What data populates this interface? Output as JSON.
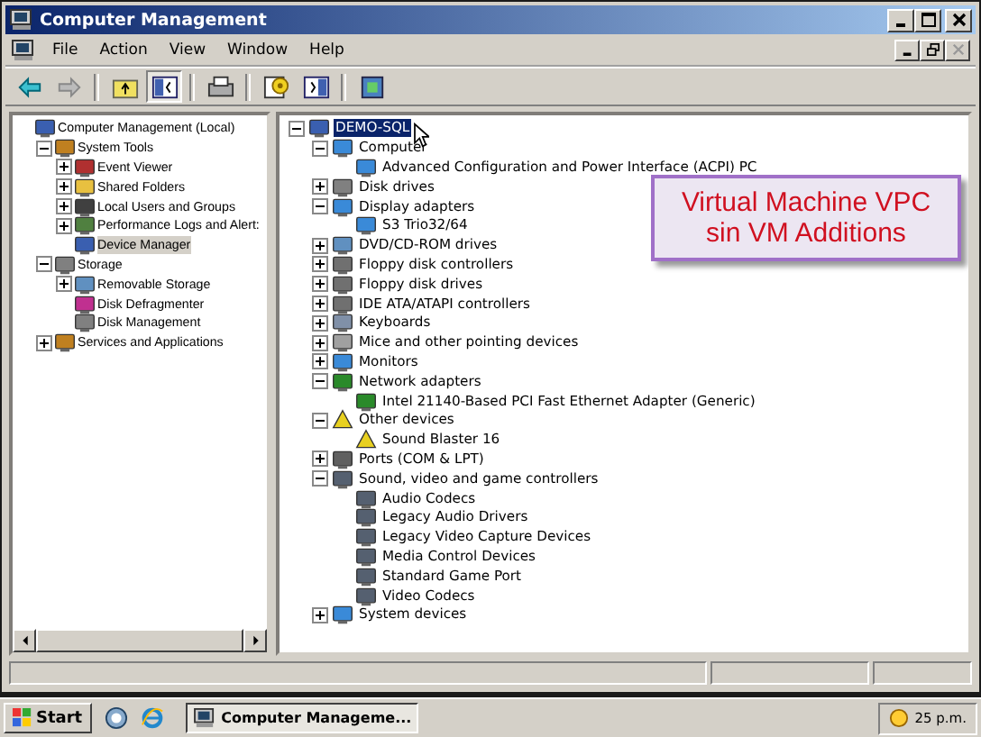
{
  "window": {
    "title": "Computer Management"
  },
  "menu": [
    "File",
    "Action",
    "View",
    "Window",
    "Help"
  ],
  "toolbar": [
    {
      "kind": "back"
    },
    {
      "kind": "forward"
    },
    {
      "kind": "sep"
    },
    {
      "kind": "up"
    },
    {
      "kind": "tree",
      "selected": true
    },
    {
      "kind": "sep"
    },
    {
      "kind": "print"
    },
    {
      "kind": "sep"
    },
    {
      "kind": "help"
    },
    {
      "kind": "pane",
      "selected": false
    },
    {
      "kind": "sep"
    },
    {
      "kind": "props"
    }
  ],
  "console_tree": [
    {
      "label": "Computer Management (Local)",
      "kind": "computer",
      "selected": false,
      "children": [
        {
          "label": "System Tools",
          "kind": "tools",
          "expanded": true,
          "selected": false,
          "children": [
            {
              "label": "Event Viewer",
              "kind": "log",
              "expanded": false,
              "selected": false
            },
            {
              "label": "Shared Folders",
              "kind": "folder",
              "expanded": false,
              "selected": false
            },
            {
              "label": "Local Users and Groups",
              "kind": "users",
              "expanded": false,
              "selected": false
            },
            {
              "label": "Performance Logs and Alert:",
              "kind": "chart",
              "expanded": false,
              "selected": false
            },
            {
              "label": "Device Manager",
              "kind": "computer",
              "selected": true
            }
          ]
        },
        {
          "label": "Storage",
          "kind": "drive",
          "expanded": true,
          "selected": false,
          "children": [
            {
              "label": "Removable Storage",
              "kind": "disc",
              "expanded": false,
              "selected": false
            },
            {
              "label": "Disk Defragmenter",
              "kind": "defrag",
              "selected": false
            },
            {
              "label": "Disk Management",
              "kind": "drive",
              "selected": false
            }
          ]
        },
        {
          "label": "Services and Applications",
          "kind": "tools",
          "expanded": false,
          "selected": false
        }
      ]
    }
  ],
  "device_tree": [
    {
      "label": "DEMO-SQL",
      "kind": "computer",
      "expanded": true,
      "selected": true,
      "children": [
        {
          "label": "Computer",
          "kind": "monitor",
          "expanded": true,
          "selected": false,
          "children": [
            {
              "label": "Advanced Configuration and Power Interface (ACPI) PC",
              "kind": "monitor",
              "selected": false
            }
          ]
        },
        {
          "label": "Disk drives",
          "kind": "drive",
          "expanded": false,
          "selected": false
        },
        {
          "label": "Display adapters",
          "kind": "monitor",
          "expanded": true,
          "selected": false,
          "children": [
            {
              "label": "S3 Trio32/64",
              "kind": "monitor",
              "selected": false
            }
          ]
        },
        {
          "label": "DVD/CD-ROM drives",
          "kind": "disc",
          "expanded": false,
          "selected": false
        },
        {
          "label": "Floppy disk controllers",
          "kind": "device",
          "expanded": false,
          "selected": false
        },
        {
          "label": "Floppy disk drives",
          "kind": "device",
          "expanded": false,
          "selected": false
        },
        {
          "label": "IDE ATA/ATAPI controllers",
          "kind": "device",
          "expanded": false,
          "selected": false
        },
        {
          "label": "Keyboards",
          "kind": "keyboard",
          "expanded": false,
          "selected": false
        },
        {
          "label": "Mice and other pointing devices",
          "kind": "mouse",
          "expanded": false,
          "selected": false
        },
        {
          "label": "Monitors",
          "kind": "monitor",
          "expanded": false,
          "selected": false
        },
        {
          "label": "Network adapters",
          "kind": "card",
          "expanded": true,
          "selected": false,
          "children": [
            {
              "label": "Intel 21140-Based PCI Fast Ethernet Adapter (Generic)",
              "kind": "card",
              "selected": false
            }
          ]
        },
        {
          "label": "Other devices",
          "kind": "warning",
          "expanded": true,
          "selected": false,
          "children": [
            {
              "label": "Sound Blaster 16",
              "kind": "warning",
              "selected": false
            }
          ]
        },
        {
          "label": "Ports (COM & LPT)",
          "kind": "port",
          "expanded": false,
          "selected": false
        },
        {
          "label": "Sound, video and game controllers",
          "kind": "sound",
          "expanded": true,
          "selected": false,
          "children": [
            {
              "label": "Audio Codecs",
              "kind": "sound",
              "selected": false
            },
            {
              "label": "Legacy Audio Drivers",
              "kind": "sound",
              "selected": false
            },
            {
              "label": "Legacy Video Capture Devices",
              "kind": "sound",
              "selected": false
            },
            {
              "label": "Media Control Devices",
              "kind": "sound",
              "selected": false
            },
            {
              "label": "Standard Game Port",
              "kind": "sound",
              "selected": false
            },
            {
              "label": "Video Codecs",
              "kind": "sound",
              "selected": false
            }
          ]
        },
        {
          "label": "System devices",
          "kind": "monitor",
          "expanded": false,
          "selected": false
        }
      ]
    }
  ],
  "callout": {
    "lines": [
      "Virtual Machine VPC",
      "sin VM Additions"
    ]
  },
  "taskbar": {
    "start": "Start",
    "task": "Computer Manageme...",
    "clock": "25 p.m."
  }
}
